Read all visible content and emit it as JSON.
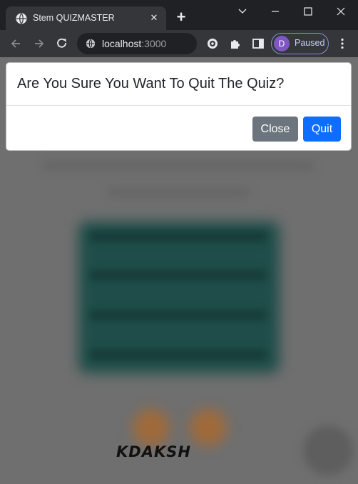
{
  "browser": {
    "tab_title": "Stem QUIZMASTER",
    "url_host": "localhost",
    "url_port": ":3000",
    "profile_initial": "D",
    "profile_status": "Paused"
  },
  "page": {
    "brand_text": "KDAKSH"
  },
  "modal": {
    "title": "Are You Sure You Want To Quit The Quiz?",
    "close_label": "Close",
    "quit_label": "Quit"
  },
  "colors": {
    "close_button": "#6c757d",
    "quit_button": "#0d6efd",
    "backdrop": "#6f6f6f",
    "quiz_card": "#1f4e4a"
  }
}
